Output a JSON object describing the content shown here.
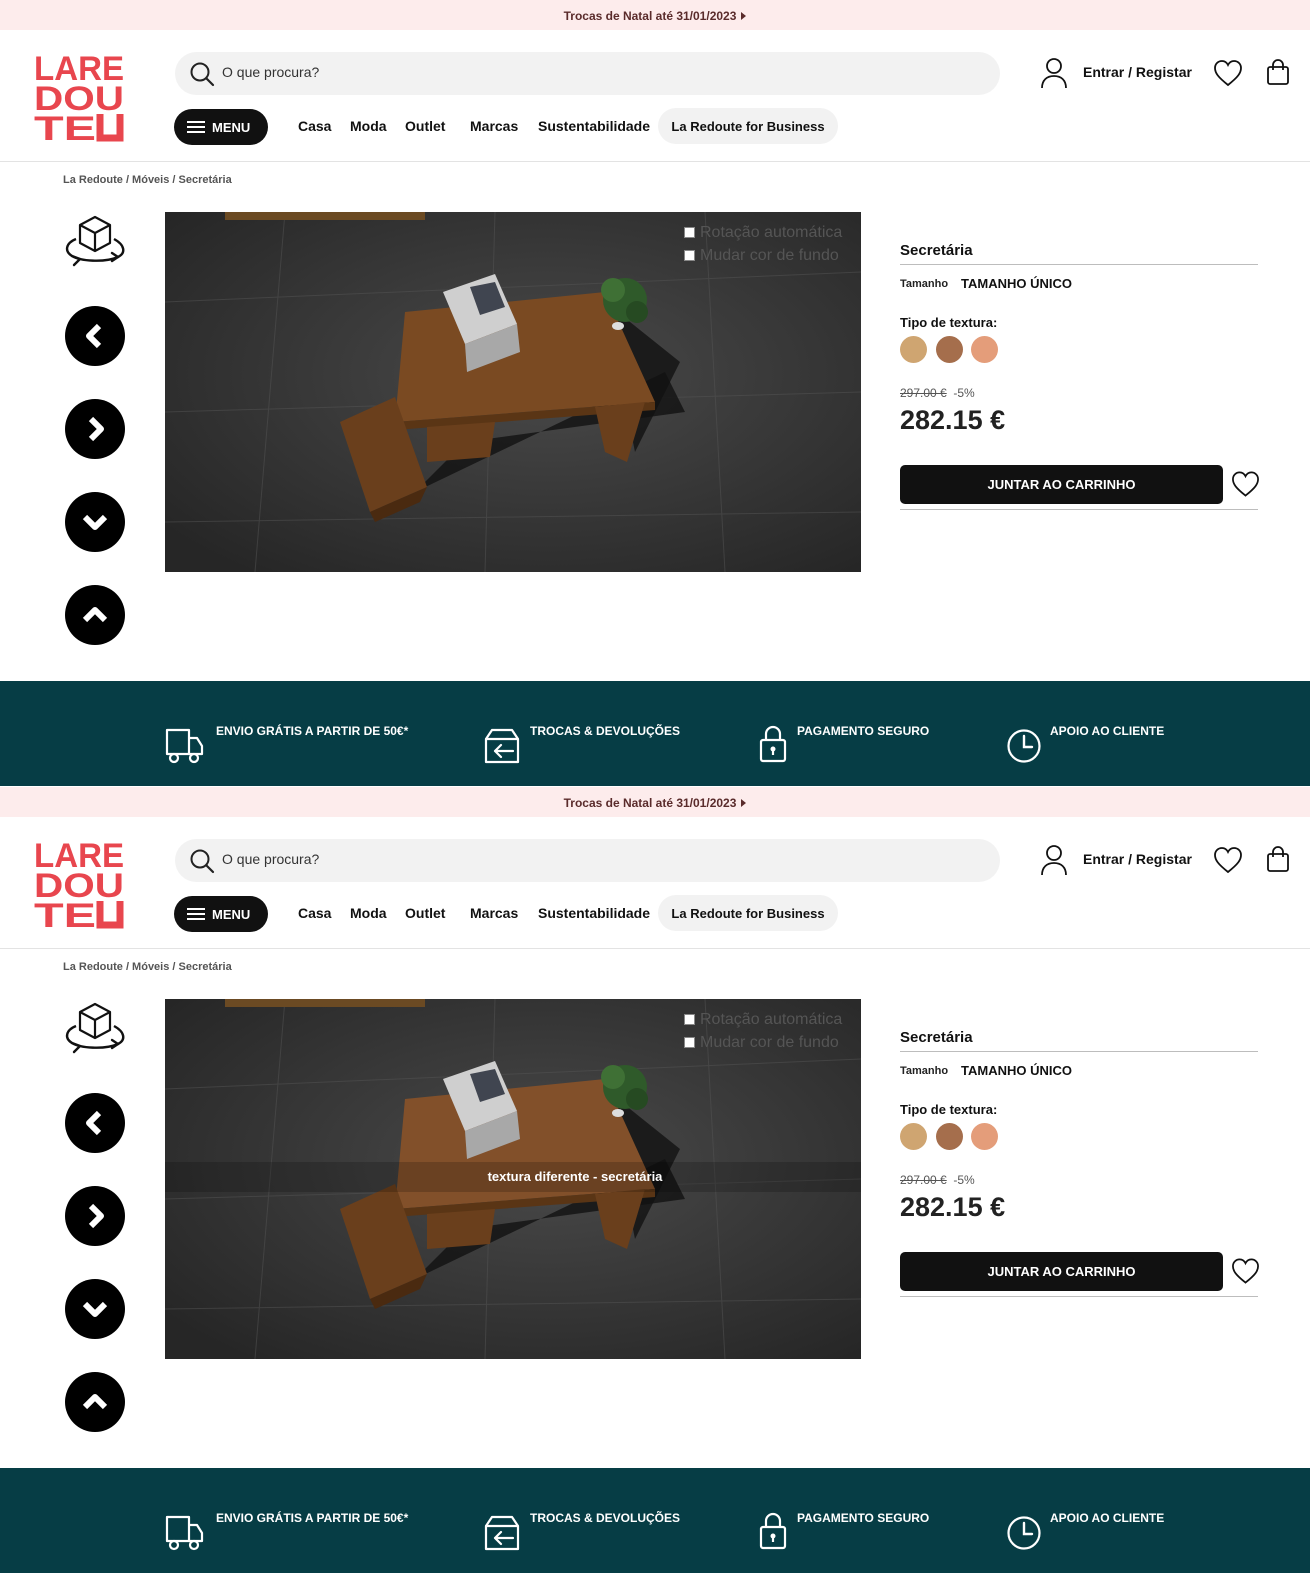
{
  "colors": {
    "accent_red": "#e8464e",
    "footer_teal": "#063d45",
    "promo_bg": "#fdecec",
    "button_dark": "#111111",
    "swatch_1": "#cfa571",
    "swatch_2": "#a56e4c",
    "swatch_3": "#e49d7a"
  },
  "promo": {
    "text": "Trocas de Natal até 31/01/2023"
  },
  "header": {
    "logo_letters": [
      "LARE",
      "DOU",
      "TE"
    ],
    "search_placeholder": "O que procura?",
    "login_label": "Entrar / Registar",
    "menu_label": "MENU",
    "nav": [
      "Casa",
      "Moda",
      "Outlet",
      "Marcas",
      "Sustentabilidade"
    ],
    "business_label": "La Redoute for Business"
  },
  "breadcrumb": {
    "text": "La Redoute / Móveis / Secretária"
  },
  "viewer": {
    "options": [
      "Rotação automática",
      "Mudar cor de fundo"
    ],
    "caption": "textura diferente - secretária",
    "controls": [
      "rotate-3d-icon",
      "arrow-left-icon",
      "arrow-right-icon",
      "arrow-down-icon",
      "arrow-up-icon"
    ]
  },
  "product": {
    "title": "Secretária",
    "size_label": "Tamanho",
    "size_value": "TAMANHO ÚNICO",
    "texture_label": "Tipo de textura:",
    "old_price": "297.00 €",
    "discount": "-5%",
    "price": "282.15 €",
    "cart_label": "JUNTAR AO CARRINHO"
  },
  "footer": {
    "features": [
      {
        "icon": "truck-icon",
        "label": "ENVIO GRÁTIS A PARTIR DE 50€*"
      },
      {
        "icon": "return-box-icon",
        "label": "TROCAS & DEVOLUÇÕES"
      },
      {
        "icon": "padlock-icon",
        "label": "PAGAMENTO SEGURO"
      },
      {
        "icon": "clock-icon",
        "label": "APOIO AO CLIENTE"
      }
    ]
  }
}
